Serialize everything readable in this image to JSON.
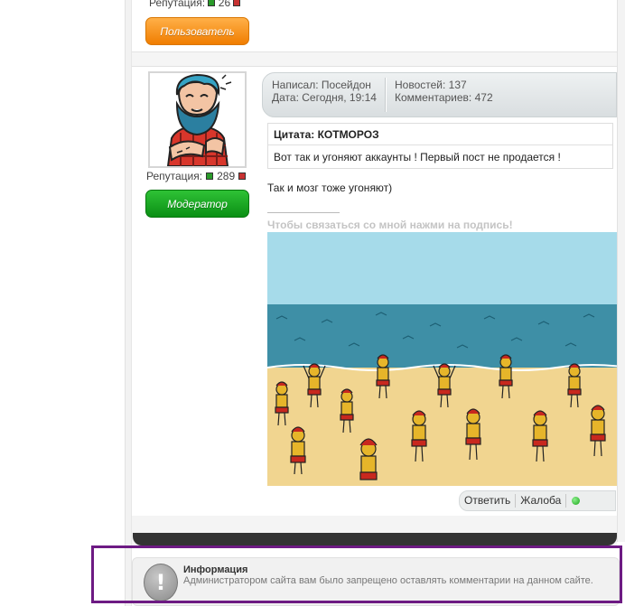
{
  "prev_post": {
    "reputation_label": "Репутация:",
    "reputation_value": "26",
    "role": "Пользователь"
  },
  "post": {
    "author_label": "Написал:",
    "author": "Посейдон",
    "date_label": "Дата:",
    "date": "Сегодня, 19:14",
    "news_label": "Новостей:",
    "news_count": "137",
    "comments_label": "Комментариев:",
    "comments_count": "472",
    "reputation_label": "Репутация:",
    "reputation_value": "289",
    "role": "Модератор",
    "quote_author": "Цитата: КОТМОРОЗ",
    "quote_text": "Вот так и угоняют аккаунты ! Первый пост не продается !",
    "text": "Так и мозг тоже угоняют)",
    "signature": "Чтобы связаться со мной нажми на подпись!",
    "actions": {
      "reply": "Ответить",
      "complaint": "Жалоба"
    },
    "online_color": "#22aa22"
  },
  "info": {
    "icon": "exclamation-icon",
    "title": "Информация",
    "text": "Администратором сайта вам было запрещено оставлять комментарии на данном сайте."
  },
  "colors": {
    "role_user": "#f08a10",
    "role_moderator": "#14a01c",
    "highlight": "#6d1a83"
  }
}
